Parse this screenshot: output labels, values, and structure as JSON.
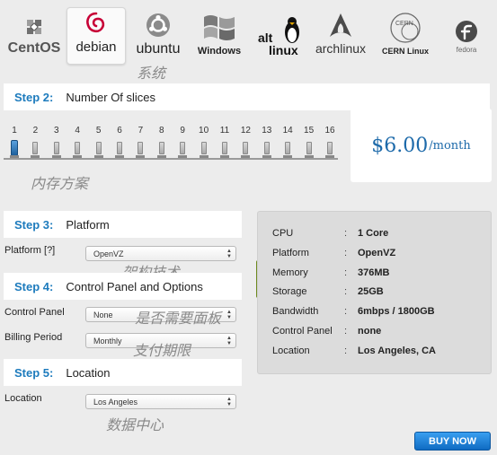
{
  "os_bar": {
    "items": [
      {
        "label": "CentOS",
        "icon": "centos-logo-icon",
        "selected": false
      },
      {
        "label": "debian",
        "icon": "debian-swirl-icon",
        "selected": true
      },
      {
        "label": "ubuntu",
        "icon": "ubuntu-circle-icon",
        "selected": false
      },
      {
        "label": "Windows",
        "icon": "windows-flag-icon",
        "selected": false
      },
      {
        "label": "alt linux",
        "icon": "alt-linux-penguin-icon",
        "selected": false
      },
      {
        "label": "archlinux",
        "icon": "arch-triangle-icon",
        "selected": false
      },
      {
        "label": "CERN Linux",
        "icon": "cern-logo-icon",
        "selected": false
      },
      {
        "label": "fedora",
        "icon": "fedora-logo-icon",
        "selected": false
      }
    ],
    "annotation": "系统"
  },
  "step2": {
    "num": "Step 2:",
    "title": "Number Of slices",
    "ticks": [
      "1",
      "2",
      "3",
      "4",
      "5",
      "6",
      "7",
      "8",
      "9",
      "10",
      "11",
      "12",
      "13",
      "14",
      "15",
      "16"
    ],
    "selected_value": 1,
    "annotation": "内存方案"
  },
  "price": {
    "amount": "$6.00",
    "period": "/month"
  },
  "step3": {
    "num": "Step 3:",
    "title": "Platform",
    "platform_label": "Platform [?]",
    "platform_value": "OpenVZ",
    "annotation": "架构技术"
  },
  "step4": {
    "num": "Step 4:",
    "title": "Control Panel and Options",
    "control_panel_label": "Control Panel",
    "control_panel_value": "None",
    "billing_label": "Billing Period",
    "billing_value": "Monthly",
    "annotation_control": "是否需要面板",
    "annotation_billing": "支付期限"
  },
  "step5": {
    "num": "Step 5:",
    "title": "Location",
    "location_label": "Location",
    "location_value": "Los Angeles",
    "annotation": "数据中心"
  },
  "summary": {
    "separator": ":",
    "rows": [
      {
        "key": "CPU",
        "value": "1 Core"
      },
      {
        "key": "Platform",
        "value": "OpenVZ"
      },
      {
        "key": "Memory",
        "value": "376MB"
      },
      {
        "key": "Storage",
        "value": "25GB"
      },
      {
        "key": "Bandwidth",
        "value": "6mbps / 1800GB"
      },
      {
        "key": "Control Panel",
        "value": "none"
      },
      {
        "key": "Location",
        "value": "Los Angeles, CA"
      }
    ]
  },
  "buy_button": "BUY NOW",
  "colors": {
    "accent_blue": "#1d7bbd",
    "price_blue": "#1d6aaa",
    "pointer_green": "#6e8a1e",
    "buy_button": "#1a7fd6"
  }
}
